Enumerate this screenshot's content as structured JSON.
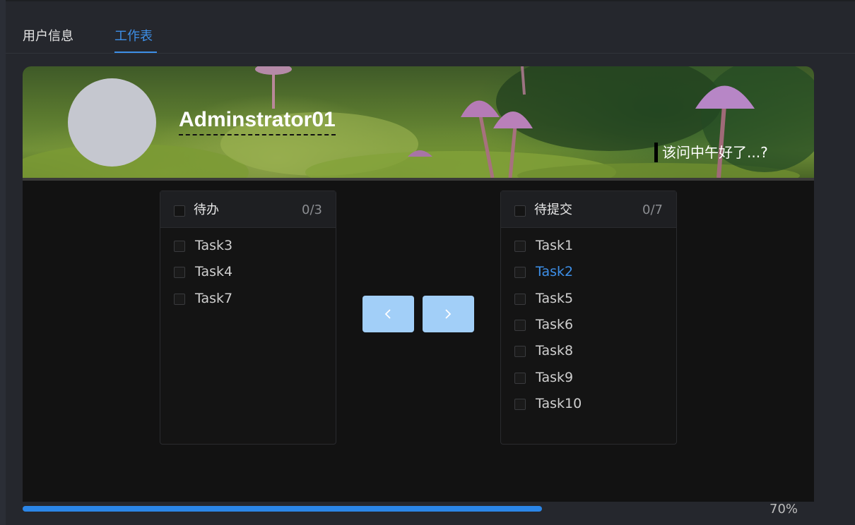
{
  "tabs": {
    "user_info": "用户信息",
    "worksheet": "工作表"
  },
  "profile": {
    "username": "Adminstrator01",
    "greeting": "该问中午好了...?"
  },
  "transfer": {
    "left": {
      "title": "待办",
      "count": "0/3",
      "items": [
        "Task3",
        "Task4",
        "Task7"
      ]
    },
    "right": {
      "title": "待提交",
      "count": "0/7",
      "items": [
        "Task1",
        "Task2",
        "Task5",
        "Task6",
        "Task8",
        "Task9",
        "Task10"
      ],
      "highlighted": "Task2"
    },
    "buttons": {
      "to_left_icon": "chevron-left-icon",
      "to_right_icon": "chevron-right-icon"
    }
  },
  "progress": {
    "value": 70,
    "label": "70%"
  },
  "colors": {
    "accent": "#3d8fe8",
    "button": "#a2cff8",
    "progress": "#2b86e8"
  }
}
